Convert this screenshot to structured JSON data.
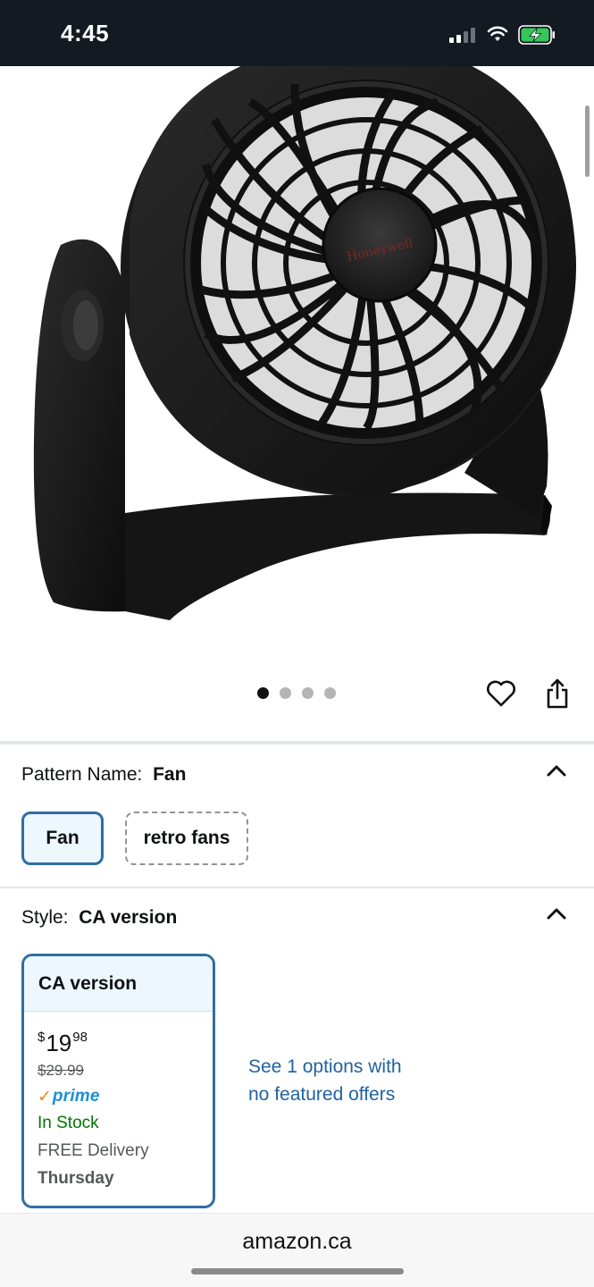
{
  "status_bar": {
    "time": "4:45"
  },
  "product": {
    "brand_logo_text": "Honeywell",
    "image_count": 4,
    "active_image": 1
  },
  "variations": {
    "pattern": {
      "label": "Pattern Name:",
      "selected": "Fan",
      "options": [
        "Fan",
        "retro fans"
      ]
    },
    "style": {
      "label": "Style:",
      "selected": "CA version",
      "card": {
        "title": "CA version",
        "price_symbol": "$",
        "price_whole": "19",
        "price_fraction": "98",
        "list_price": "$29.99",
        "prime_check": "✓",
        "prime_label": "prime",
        "availability": "In Stock",
        "delivery_line1": "FREE Delivery",
        "delivery_line2": "Thursday"
      },
      "other_offers_line1": "See 1 options with",
      "other_offers_line2": "no featured offers"
    }
  },
  "browser": {
    "url": "amazon.ca"
  },
  "colors": {
    "status_bar_bg": "#131a22",
    "selected_border": "#2e6ea6",
    "link": "#2162a1",
    "in_stock": "#007600",
    "prime_check": "#f08804",
    "prime_word": "#1a8fd6"
  }
}
